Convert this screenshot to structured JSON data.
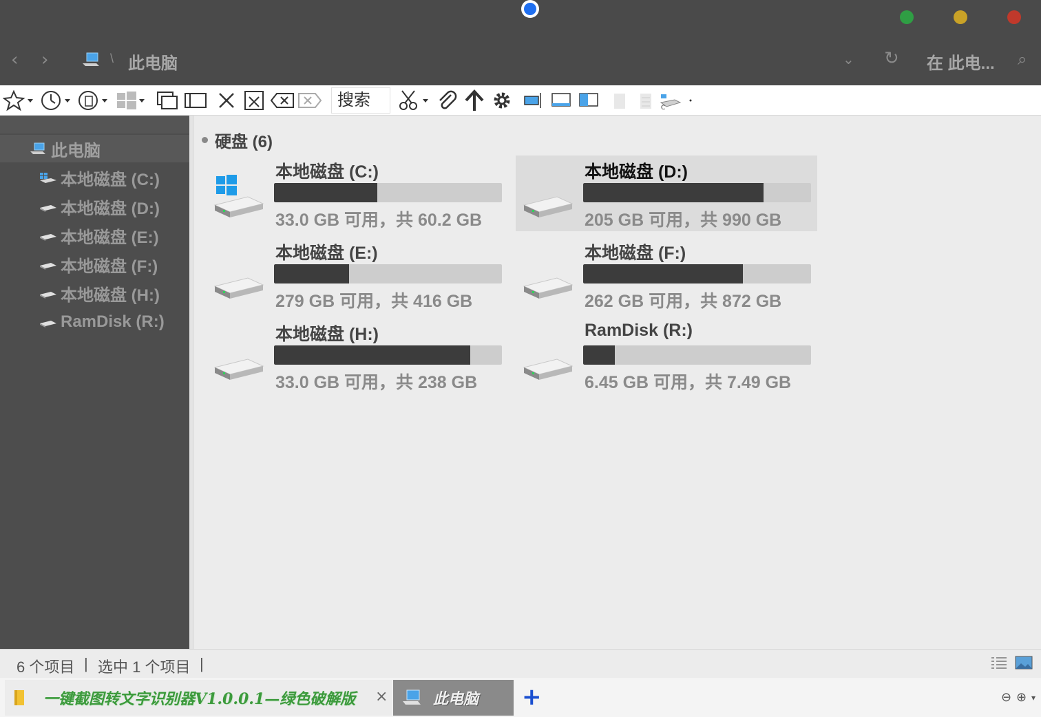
{
  "window": {
    "breadcrumb": "此电脑",
    "search_placeholder": "在 此电...",
    "icons": {
      "back": "chevron-left-icon",
      "forward": "chevron-right-icon",
      "refresh": "refresh-icon",
      "search": "search-icon"
    },
    "controls_colors": {
      "green": "#2f9e44",
      "yellow": "#c9a227",
      "red": "#c0392b"
    }
  },
  "toolbar": {
    "search_label": "搜索"
  },
  "sidebar": {
    "root": "此电脑",
    "items": [
      {
        "label": "本地磁盘 (C:)",
        "icon": "windows-drive-icon"
      },
      {
        "label": "本地磁盘 (D:)",
        "icon": "drive-icon"
      },
      {
        "label": "本地磁盘 (E:)",
        "icon": "drive-icon"
      },
      {
        "label": "本地磁盘 (F:)",
        "icon": "drive-icon"
      },
      {
        "label": "本地磁盘 (H:)",
        "icon": "drive-icon"
      },
      {
        "label": "RamDisk (R:)",
        "icon": "drive-icon"
      }
    ]
  },
  "main": {
    "group_title": "硬盘 (6)",
    "drives": [
      {
        "name": "本地磁盘 (C:)",
        "free": "33.0 GB 可用，共 60.2 GB",
        "used_fraction": 0.452,
        "selected": false,
        "windows": true
      },
      {
        "name": "本地磁盘 (D:)",
        "free": "205 GB 可用，共 990 GB",
        "used_fraction": 0.793,
        "selected": true,
        "windows": false
      },
      {
        "name": "本地磁盘 (E:)",
        "free": "279 GB 可用，共 416 GB",
        "used_fraction": 0.329,
        "selected": false,
        "windows": false
      },
      {
        "name": "本地磁盘 (F:)",
        "free": "262 GB 可用，共 872 GB",
        "used_fraction": 0.7,
        "selected": false,
        "windows": false
      },
      {
        "name": "本地磁盘 (H:)",
        "free": "33.0 GB 可用，共 238 GB",
        "used_fraction": 0.861,
        "selected": false,
        "windows": false
      },
      {
        "name": "RamDisk (R:)",
        "free": "6.45 GB 可用，共 7.49 GB",
        "used_fraction": 0.139,
        "selected": false,
        "windows": false
      }
    ]
  },
  "status": {
    "count": "6 个项目",
    "selected": "选中 1 个项目",
    "sep": "|"
  },
  "tabs": [
    {
      "label": "一键截图转文字识别器V1.0.0.1—绿色破解版",
      "icon": "folder-icon",
      "active": false
    },
    {
      "label": "此电脑",
      "icon": "computer-icon",
      "active": true
    }
  ],
  "tabbar": {
    "close": "×",
    "new_tab": "+"
  }
}
